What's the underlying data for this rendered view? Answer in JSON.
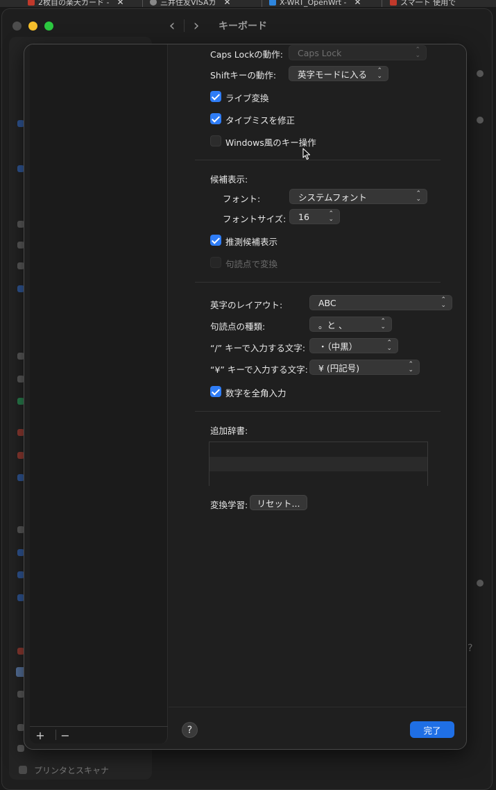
{
  "browser_tabs": [
    {
      "label": "2枚目の楽天カード -",
      "color": "#c0392b"
    },
    {
      "label": "三井住友VISAカ",
      "color": "#888888"
    },
    {
      "label": "X-WRT_OpenWrt -",
      "color": "#2e86de"
    },
    {
      "label": "スマ一ト 使用で",
      "color": "#c0392b"
    }
  ],
  "window": {
    "title": "キーボード",
    "back_icon": "chevron-left-icon",
    "forward_icon": "chevron-right-icon",
    "footer_sidebar_item": "プリンタとスキャナ",
    "help_label": "?"
  },
  "sheet": {
    "sidebar": {
      "add_label": "+",
      "remove_label": "−"
    },
    "caps_lock": {
      "label": "Caps Lockの動作:",
      "value": "Caps Lock"
    },
    "shift": {
      "label": "Shiftキーの動作:",
      "value": "英字モードに入る"
    },
    "checkboxes_top": [
      {
        "label": "ライブ変換",
        "checked": true
      },
      {
        "label": "タイプミスを修正",
        "checked": true
      },
      {
        "label": "Windows風のキー操作",
        "checked": false
      }
    ],
    "candidates": {
      "heading": "候補表示:",
      "font_label": "フォント:",
      "font_value": "システムフォント",
      "size_label": "フォントサイズ:",
      "size_value": "16",
      "predictive": {
        "label": "推測候補表示",
        "checked": true
      },
      "punct_convert": {
        "label": "句読点で変換",
        "checked": false,
        "disabled": true
      }
    },
    "layout": {
      "layout_label": "英字のレイアウト:",
      "layout_value": "ABC",
      "punct_label": "句読点の種類:",
      "punct_value": "。と 、",
      "slash_label": "“/” キーで入力する文字:",
      "slash_value": "・（中黒）",
      "yen_label": "“¥” キーで入力する文字:",
      "yen_value": "¥ (円記号)",
      "fullwidth_numbers": {
        "label": "数字を全角入力",
        "checked": true
      }
    },
    "dictionary": {
      "label": "追加辞書:"
    },
    "learning": {
      "label": "変換学習:",
      "button": "リセット..."
    },
    "footer": {
      "help": "?",
      "done": "完了"
    }
  },
  "colors": {
    "accent": "#1f6fe5",
    "checkbox": "#2f7df6"
  }
}
